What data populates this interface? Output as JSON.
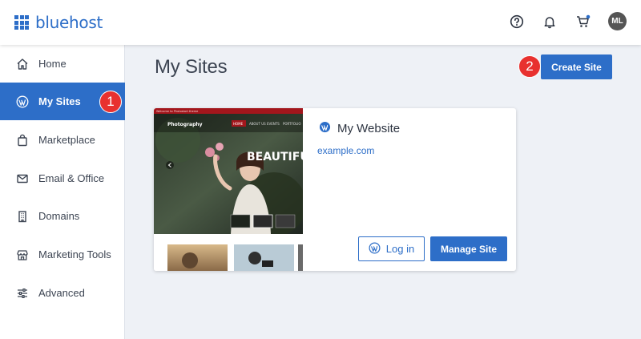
{
  "header": {
    "brand": "bluehost",
    "user_initials": "ML",
    "icons": [
      "help-icon",
      "bell-icon",
      "cart-icon"
    ]
  },
  "sidebar": {
    "items": [
      {
        "label": "Home",
        "icon": "home-icon",
        "active": false
      },
      {
        "label": "My Sites",
        "icon": "wordpress-icon",
        "active": true
      },
      {
        "label": "Marketplace",
        "icon": "shopping-bag-icon",
        "active": false
      },
      {
        "label": "Email & Office",
        "icon": "envelope-icon",
        "active": false
      },
      {
        "label": "Domains",
        "icon": "building-icon",
        "active": false
      },
      {
        "label": "Marketing Tools",
        "icon": "storefront-icon",
        "active": false
      },
      {
        "label": "Advanced",
        "icon": "sliders-icon",
        "active": false
      }
    ]
  },
  "main": {
    "title": "My Sites",
    "create_label": "Create Site"
  },
  "site_card": {
    "name": "My Website",
    "url": "example.com",
    "login_label": "Log in",
    "manage_label": "Manage Site",
    "thumbnail": {
      "topbar_text": "Welcome to Photostart theme",
      "brand": "Photography",
      "nav": [
        "HOME",
        "ABOUT US",
        "EVENTS",
        "PORTFOLIO"
      ],
      "hero_text": "BEAUTIFUL"
    }
  },
  "annotations": {
    "step1": "1",
    "step2": "2"
  },
  "colors": {
    "accent": "#2d6ec8",
    "badge": "#e8312f",
    "background": "#eef1f6"
  }
}
